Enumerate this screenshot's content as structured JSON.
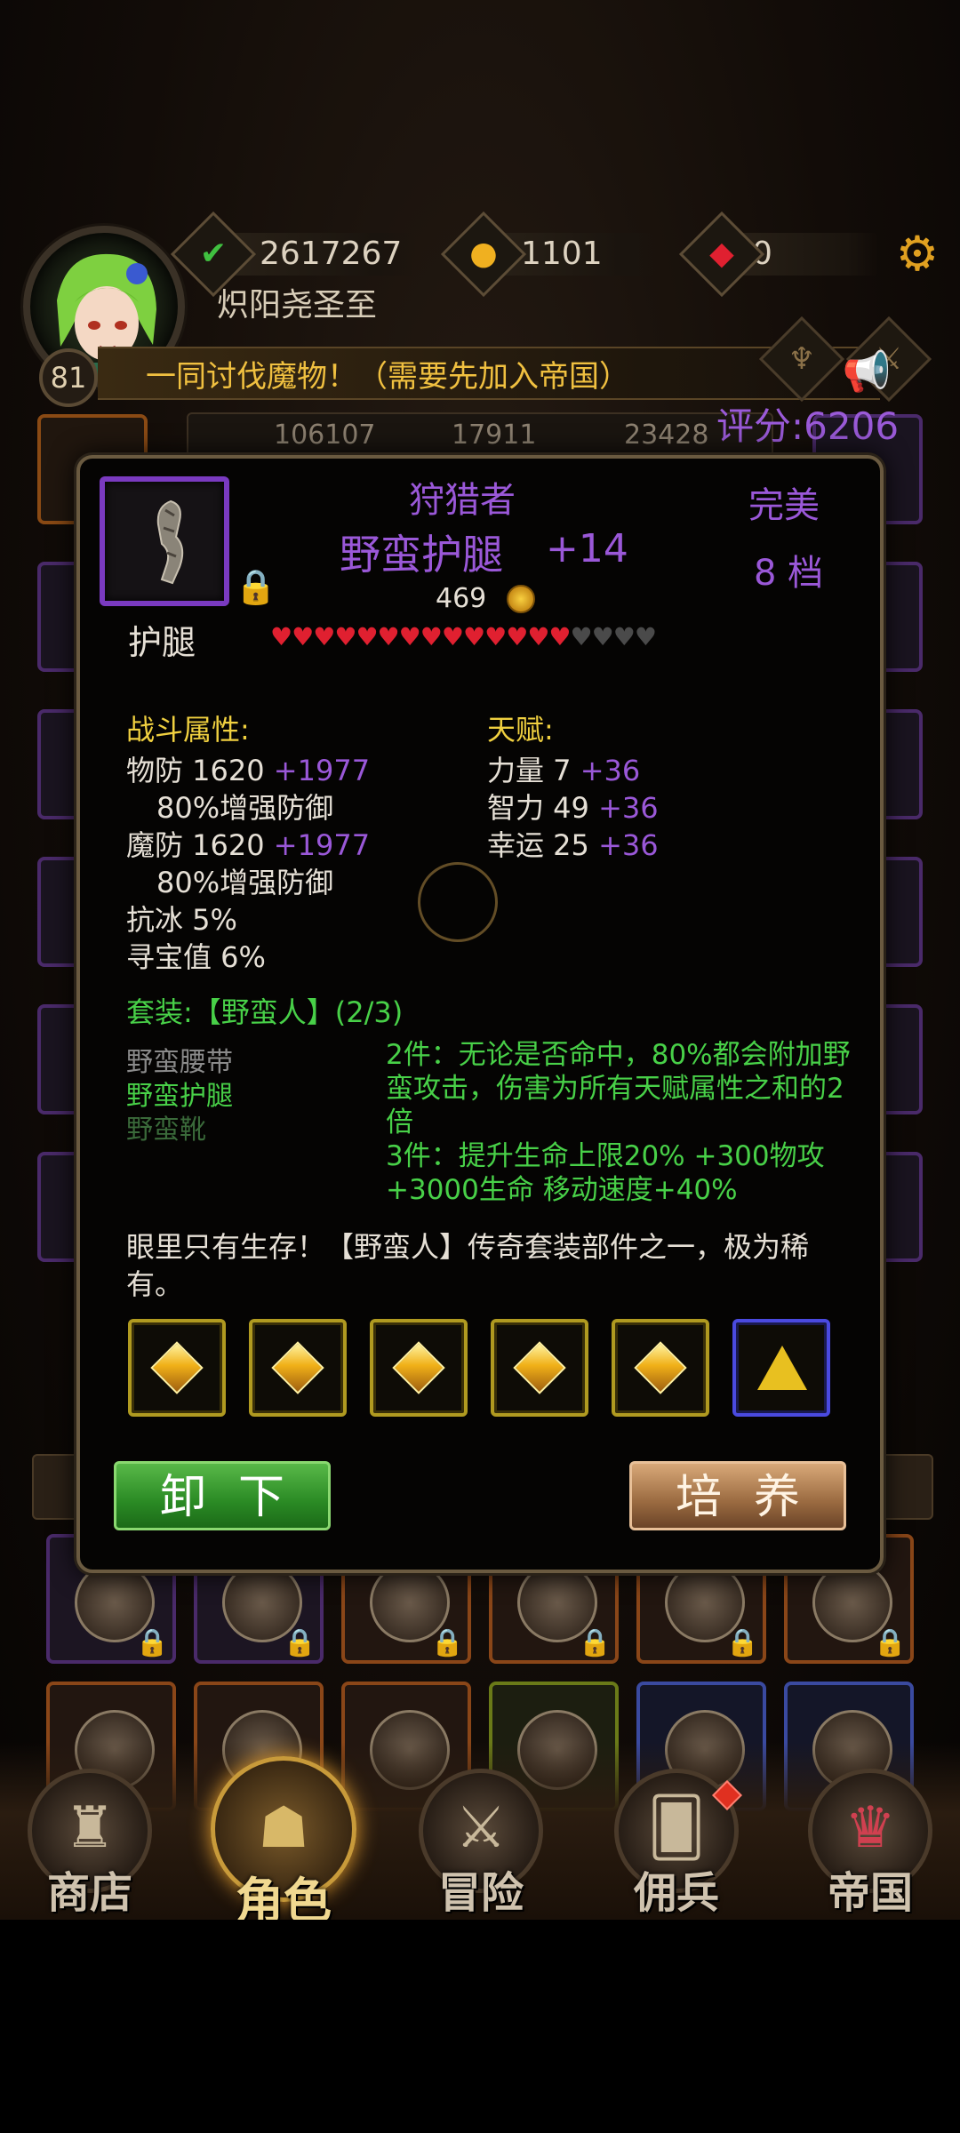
{
  "hud": {
    "level": "81",
    "player_name": "炽阳尧圣至",
    "exp": "2617267",
    "gold": "1101",
    "gems": "0",
    "marquee": "一同讨伐魔物！（需要先加入帝国）",
    "score": "评分:6206",
    "bg_stats": [
      "106107",
      "17911",
      "23428"
    ]
  },
  "item": {
    "set_name": "狩猎者",
    "name": "野蛮护腿",
    "enhance": "+14",
    "price": "469",
    "quality": "完美",
    "grade": "8 档",
    "type": "护腿",
    "hearts_filled": 14,
    "hearts_total": 18,
    "combat_header": "战斗属性:",
    "combat_stats": [
      {
        "label": "物防 1620",
        "bonus": "+1977"
      },
      {
        "label": "80%增强防御",
        "bonus": ""
      },
      {
        "label": "魔防 1620",
        "bonus": "+1977"
      },
      {
        "label": "80%增强防御",
        "bonus": ""
      },
      {
        "label": "抗冰 5%",
        "bonus": ""
      },
      {
        "label": "寻宝值 6%",
        "bonus": ""
      }
    ],
    "talent_header": "天赋:",
    "talents": [
      {
        "label": "力量 7",
        "bonus": "+36"
      },
      {
        "label": "智力 49",
        "bonus": "+36"
      },
      {
        "label": "幸运 25",
        "bonus": "+36"
      }
    ],
    "set_title": "套装:【野蛮人】(2/3)",
    "set_pieces": [
      "野蛮腰带",
      "野蛮护腿",
      "野蛮靴"
    ],
    "set_effects": [
      "2件：无论是否命中，80%都会附加野蛮攻击，伤害为所有天赋属性之和的2倍",
      "3件：提升生命上限20% +300物攻 +3000生命 移动速度+40%"
    ],
    "flavor": "眼里只有生存！【野蛮人】传奇套装部件之一，极为稀有。",
    "btn_unequip": "卸下",
    "btn_train": "培养"
  },
  "nav": [
    "商店",
    "角色",
    "冒险",
    "佣兵",
    "帝国"
  ],
  "colors": {
    "epic_purple": "#9a58d8",
    "set_green": "#48d048",
    "header_yellow": "#f0d040",
    "heart_red": "#e02030"
  }
}
